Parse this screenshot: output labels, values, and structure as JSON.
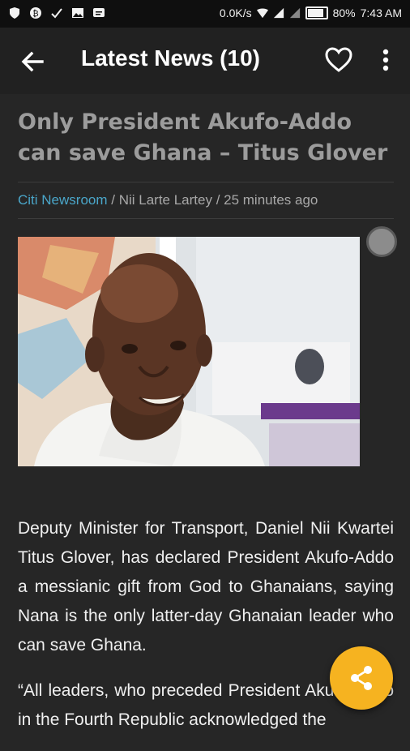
{
  "status_bar": {
    "network_speed": "0.0K/s",
    "battery": "80%",
    "time": "7:43 AM",
    "icons": [
      "shield-icon",
      "bitcoin-icon",
      "check-icon",
      "image-icon",
      "message-icon",
      "wifi-icon",
      "signal-icon",
      "signal-icon",
      "battery-icon"
    ]
  },
  "app_bar": {
    "title": "Latest News (10)",
    "back_icon": "back-arrow-icon",
    "favorite_icon": "heart-icon",
    "menu_icon": "more-vert-icon"
  },
  "article": {
    "headline": "Only President Akufo-Addo can save Ghana – Titus Glover",
    "source": "Citi Newsroom",
    "byline_rest": " / Nii Larte Lartey / 25 minutes ago",
    "paragraphs": [
      "Deputy Minister for Transport, Daniel Nii Kwartei Titus Glover, has declared President Akufo-Addo a messianic gift from God to Ghanaians, saying Nana is the only latter-day Ghanaian leader who can save Ghana.",
      "“All leaders, who preceded President Akufo-Addo in the Fourth Republic acknowledged the"
    ]
  },
  "fab": {
    "icon": "share-icon"
  },
  "colors": {
    "accent": "#f6b320",
    "source_link": "#4aa6c9",
    "background": "#262626"
  }
}
